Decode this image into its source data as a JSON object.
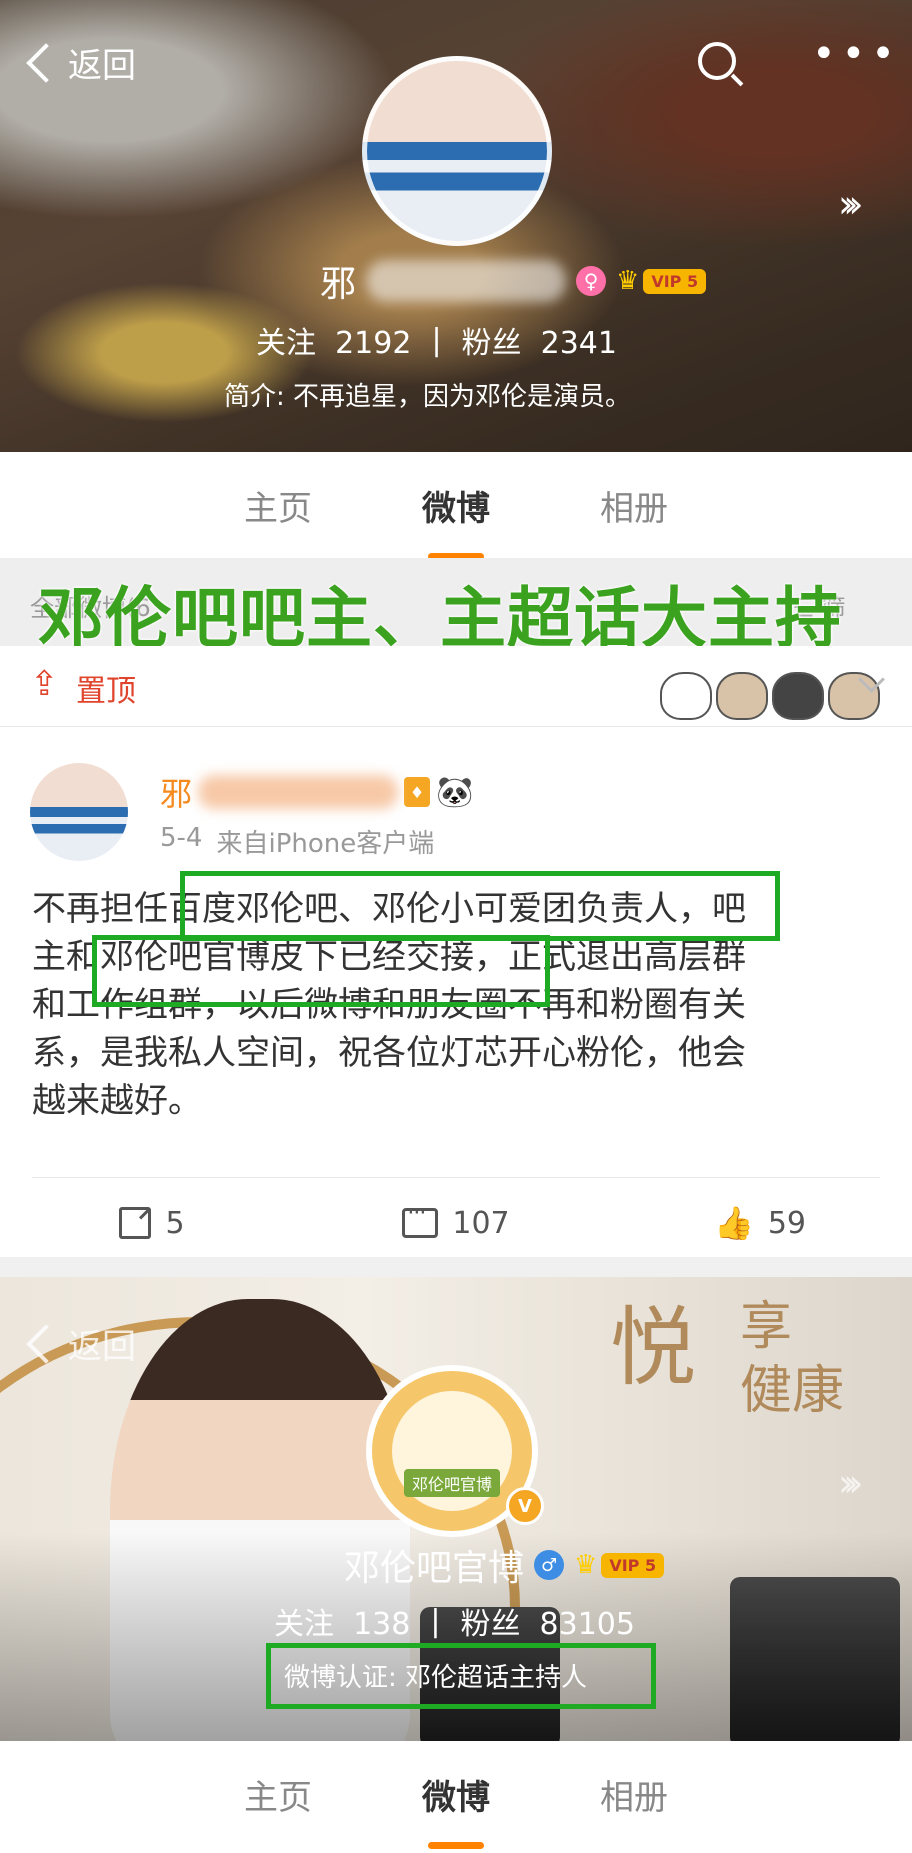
{
  "header1": {
    "back_label": "返回",
    "name_visible": "邪",
    "vip_label": "VIP 5",
    "stats": {
      "follow_label": "关注",
      "follow_count": "2192",
      "sep": "|",
      "fans_label": "粉丝",
      "fans_count": "2341"
    },
    "bio": "简介: 不再追星，因为邓伦是演员。"
  },
  "tabs": [
    "主页",
    "微博",
    "相册"
  ],
  "active_tab": "微博",
  "overlay_headline": "邓伦吧吧主、主超话大主持",
  "filter_bar": {
    "left_text": "全部微博(6",
    "right_text": "三 筛"
  },
  "pinned_label": "置顶",
  "post": {
    "author_visible": "邪",
    "time": "5-4",
    "source": "来自iPhone客户端",
    "body_lines": [
      "不再担任百度邓伦吧、邓伦小可爱团负责人，吧",
      "主和邓伦吧官博皮下已经交接，正式退出高层群",
      "和工作组群，以后微博和朋友圈不再和粉圈有关",
      "系，是我私人空间，祝各位灯芯开心粉伦，他会",
      "越来越好。"
    ],
    "reposts": "5",
    "comments": "107",
    "likes": "59"
  },
  "header2": {
    "back_label": "返回",
    "ad_big": "悦",
    "ad_small_1": "享",
    "ad_small_2": "健康",
    "logo_text": "邓伦吧官博",
    "v_badge": "V",
    "name": "邓伦吧官博",
    "vip_label": "VIP 5",
    "stats": {
      "follow_label": "关注",
      "follow_count": "138",
      "sep": "|",
      "fans_label": "粉丝",
      "fans_count": "83105"
    },
    "verify": "微博认证: 邓伦超话主持人"
  },
  "accent_colors": {
    "orange": "#ff8200",
    "highlight_green": "#1faa24",
    "headline_green": "#3aa21e",
    "pin_red": "#e0442c"
  },
  "icons": [
    "back-chevron-icon",
    "search-icon",
    "more-dots-icon",
    "chevron-right-icon",
    "female-icon",
    "crown-icon",
    "pin-icon",
    "cat-sticker-icon",
    "caret-down-icon",
    "level-badge-icon",
    "panda-icon",
    "repost-icon",
    "comment-icon",
    "like-icon",
    "verified-v-icon",
    "male-icon"
  ]
}
